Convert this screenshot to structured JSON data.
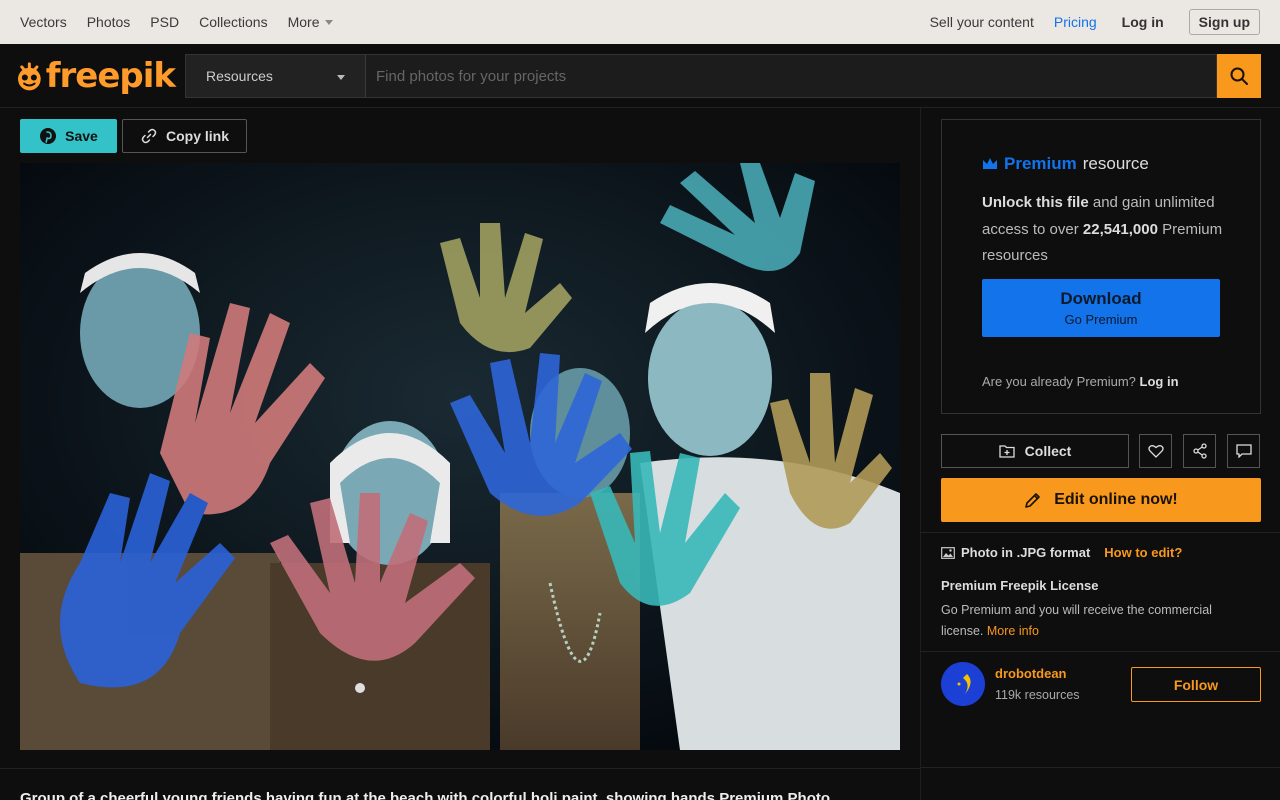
{
  "topnav": {
    "items": [
      {
        "label": "Vectors"
      },
      {
        "label": "Photos"
      },
      {
        "label": "PSD"
      },
      {
        "label": "Collections"
      },
      {
        "label": "More"
      }
    ],
    "sell": "Sell your content",
    "pricing": "Pricing",
    "login": "Log in",
    "signup": "Sign up"
  },
  "header": {
    "logo": "freepik",
    "select_value": "Resources",
    "search_placeholder": "Find photos for your projects"
  },
  "actions": {
    "save": "Save",
    "copy_link": "Copy link"
  },
  "caption": "Group of a cheerful young friends having fun at the beach with colorful holi paint, showing hands Premium Photo",
  "premium": {
    "title_blue": "Premium",
    "title_rest": "resource",
    "unlock_bold": "Unlock this file",
    "unlock_rest": "and gain unlimited access to over",
    "count": "22,541,000",
    "count_rest": "Premium resources",
    "download": "Download",
    "go_premium": "Go Premium",
    "already": "Are you already Premium?",
    "login": "Log in"
  },
  "tools": {
    "collect": "Collect",
    "edit": "Edit online now!"
  },
  "info": {
    "format": "Photo in .JPG format",
    "howto": "How to edit?",
    "license_title": "Premium Freepik License",
    "license_text": "Go Premium and you will receive the commercial license.",
    "more_info": "More info"
  },
  "author": {
    "name": "drobotdean",
    "resources": "119k resources",
    "follow": "Follow"
  },
  "colors": {
    "accent_orange": "#f8981d",
    "premium_blue": "#1273eb",
    "save_teal": "#32c2c8"
  }
}
